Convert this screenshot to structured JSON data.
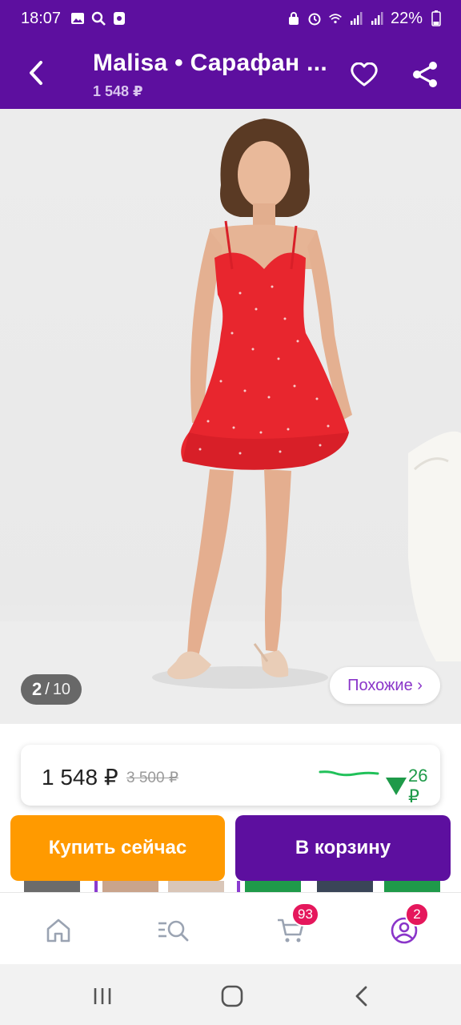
{
  "status_bar": {
    "time": "18:07",
    "battery": "22%",
    "left_icons": [
      "image-icon",
      "search-icon",
      "app-icon"
    ],
    "right_icons": [
      "lock-icon",
      "alarm-icon",
      "wifi-icon",
      "signal-icon",
      "signal-icon",
      "battery-icon"
    ]
  },
  "header": {
    "title": "Malisa • Сарафан ...",
    "price": "1 548 ₽",
    "back_icon": "chevron-left-icon",
    "favorite_icon": "heart-icon",
    "share_icon": "share-icon"
  },
  "gallery": {
    "current": "2",
    "separator": "/",
    "total": "10",
    "similar_label": "Похожие ›"
  },
  "price_card": {
    "price": "1 548 ₽",
    "old_price": "3 500 ₽",
    "trend_value": "26 ₽",
    "trend_direction": "down",
    "trend_color": "#1e9a49"
  },
  "actions": {
    "buy_now": "Купить сейчас",
    "add_to_cart": "В корзину",
    "buy_color": "#ff9a00",
    "cart_color": "#5d0f9f"
  },
  "bottom_nav": {
    "items": [
      {
        "icon": "home-icon",
        "badge": ""
      },
      {
        "icon": "catalog-search-icon",
        "badge": ""
      },
      {
        "icon": "cart-icon",
        "badge": "93"
      },
      {
        "icon": "profile-icon",
        "badge": "2"
      }
    ]
  },
  "theme": {
    "brand_purple": "#5d0f9f",
    "badge_pink": "#e5175c"
  }
}
